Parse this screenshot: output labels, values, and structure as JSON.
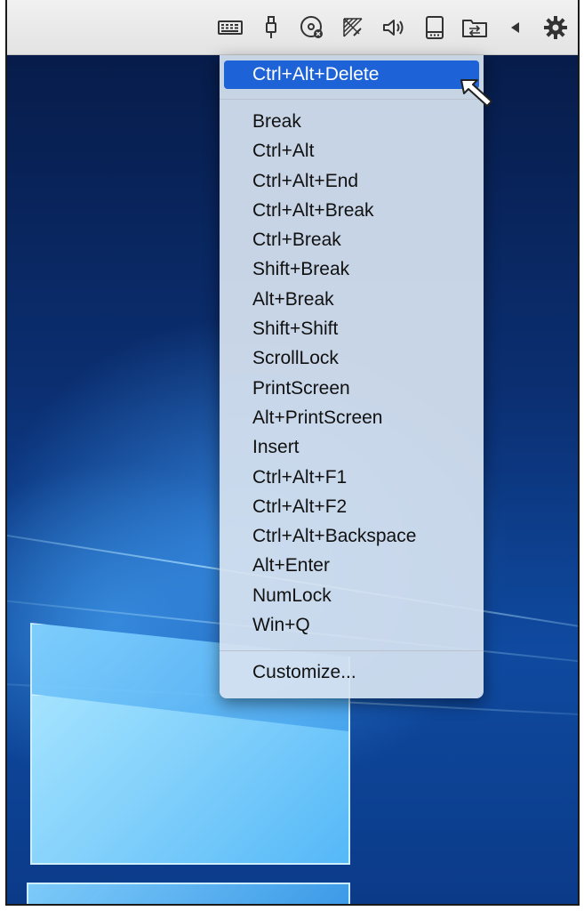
{
  "toolbar": {
    "icons": [
      "keyboard-icon",
      "usb-icon",
      "optical-disk-icon",
      "network-icon",
      "audio-icon",
      "storage-icon",
      "shared-folder-icon",
      "collapse-arrow-icon",
      "gear-icon"
    ]
  },
  "menu": {
    "highlighted": "Ctrl+Alt+Delete",
    "items": [
      "Break",
      "Ctrl+Alt",
      "Ctrl+Alt+End",
      "Ctrl+Alt+Break",
      "Ctrl+Break",
      "Shift+Break",
      "Alt+Break",
      "Shift+Shift",
      "ScrollLock",
      "PrintScreen",
      "Alt+PrintScreen",
      "Insert",
      "Ctrl+Alt+F1",
      "Ctrl+Alt+F2",
      "Ctrl+Alt+Backspace",
      "Alt+Enter",
      "NumLock",
      "Win+Q"
    ],
    "customize": "Customize..."
  },
  "colors": {
    "highlight": "#1d62d6",
    "menu_background": "#d6e2f0",
    "toolbar_background": "#eaeaea",
    "desktop": "#0b2f72"
  }
}
